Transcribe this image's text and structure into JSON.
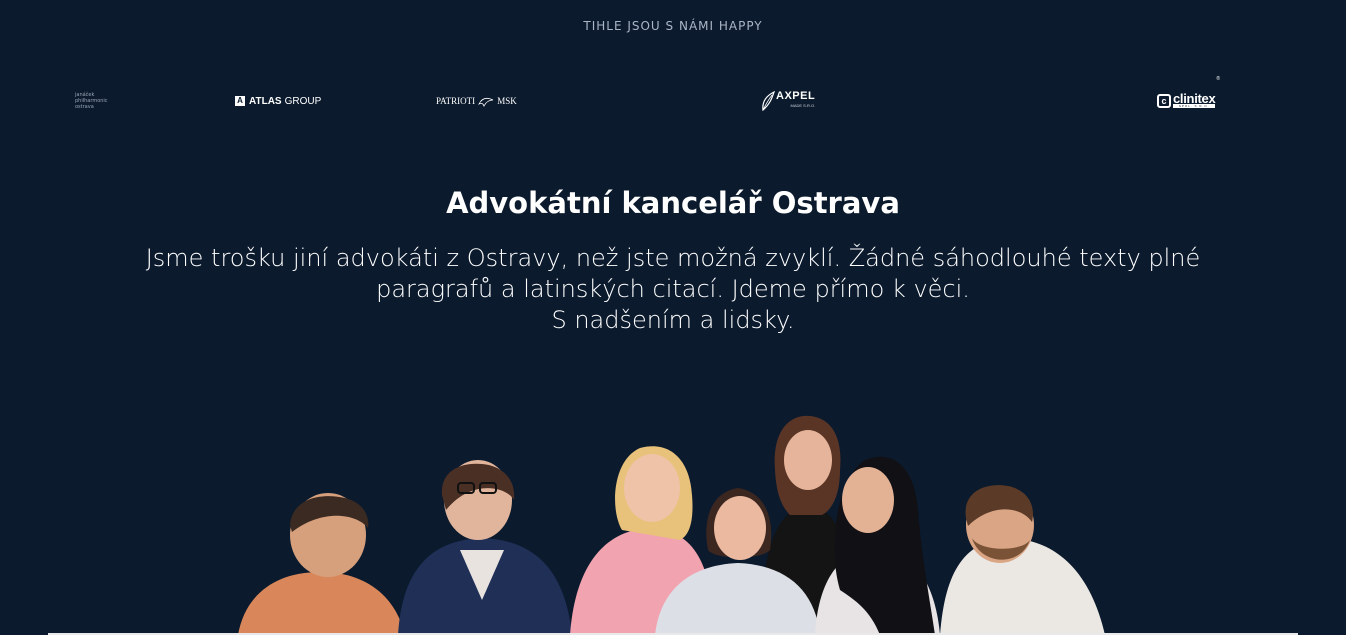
{
  "eyebrow": "TIHLE JSOU S NÁMI HAPPY",
  "logos": {
    "jph": [
      "janáček",
      "philharmonic",
      "ostrava"
    ],
    "atlas": {
      "mark": "A",
      "strong": "ATLAS",
      "rest": "GROUP"
    },
    "patrioti": {
      "left": "PATRIOTI",
      "right": "MSK"
    },
    "axpel": {
      "name": "AXPEL",
      "sub": "MADE S.R.O."
    },
    "clinitex": {
      "mark": "c",
      "name": "clinitex",
      "reg": "®",
      "sub": "SPOL. S R.O."
    }
  },
  "heading": "Advokátní kancelář Ostrava",
  "intro": {
    "line1": "Jsme trošku jiní advokáti z Ostravy, než jste možná zvyklí. Žádné sáhodlouhé texty plné",
    "line2": "paragrafů a latinských citací. Jdeme přímo k věci.",
    "line3": "S nadšením a lidsky."
  },
  "colors": {
    "background": "#0b1a2d",
    "text": "#ffffff",
    "muted": "#aab6c6"
  }
}
